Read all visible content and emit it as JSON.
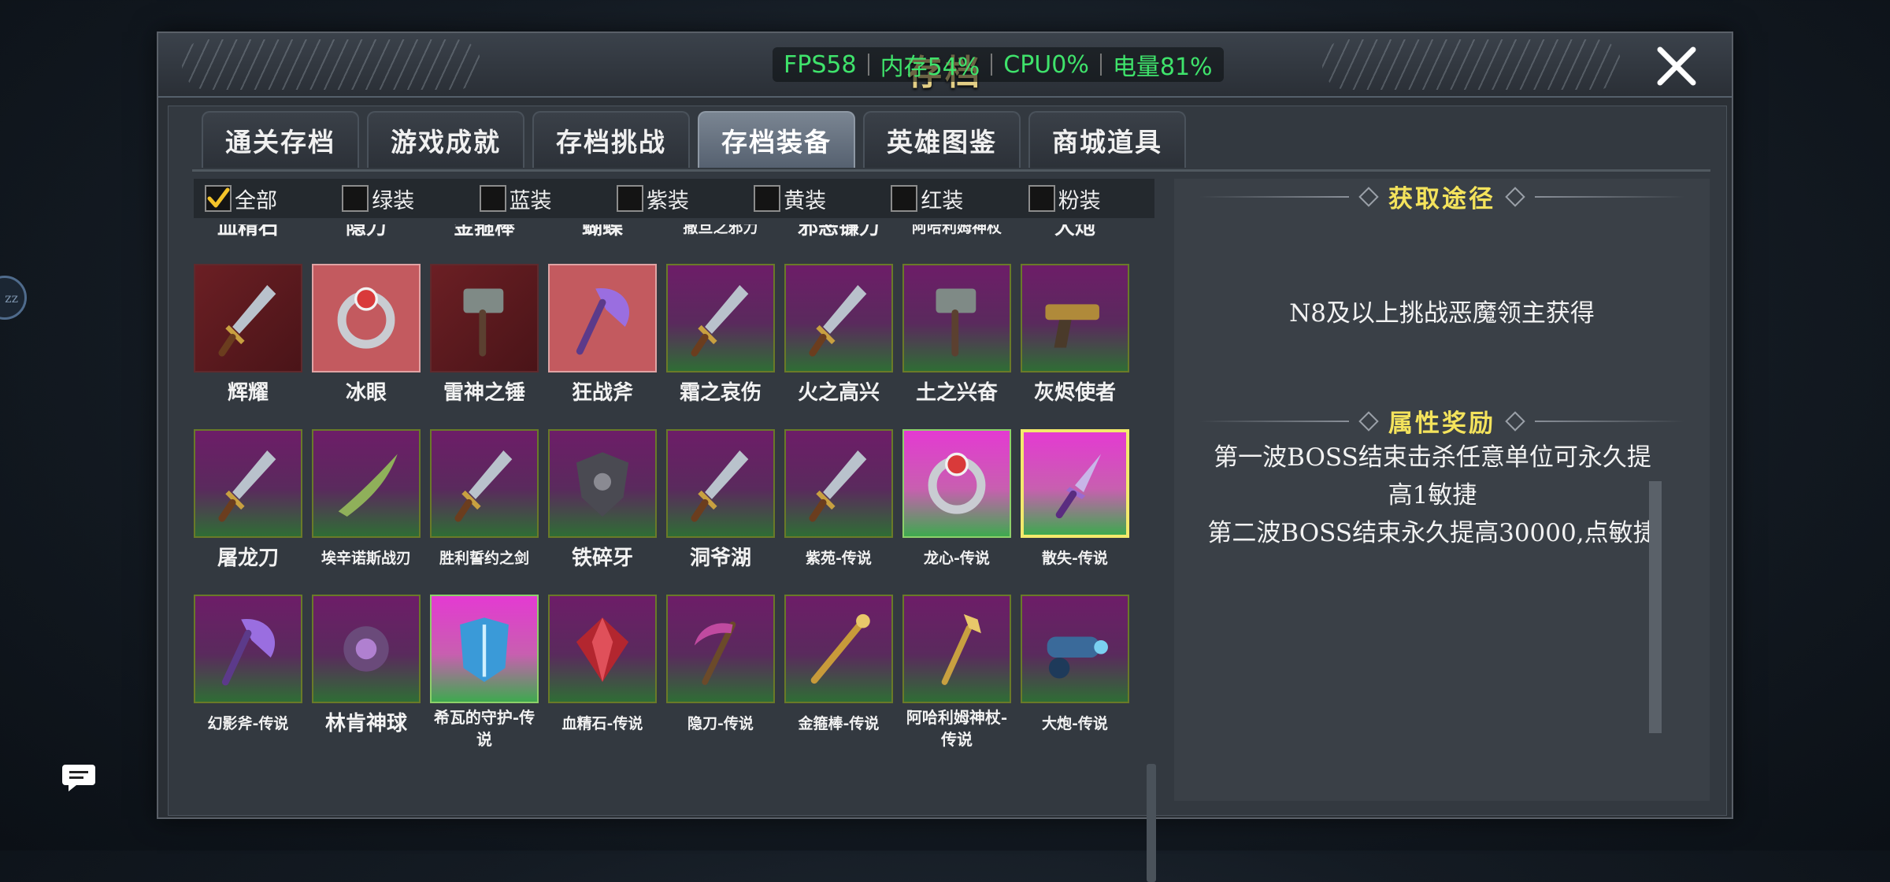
{
  "panel": {
    "title": "存档"
  },
  "perf": {
    "fps": "FPS58",
    "mem": "内存54%",
    "cpu": "CPU0%",
    "battery": "电量81%"
  },
  "side_badge": "zz",
  "tabs": [
    {
      "label": "通关存档",
      "active": false
    },
    {
      "label": "游戏成就",
      "active": false
    },
    {
      "label": "存档挑战",
      "active": false
    },
    {
      "label": "存档装备",
      "active": true
    },
    {
      "label": "英雄图鉴",
      "active": false
    },
    {
      "label": "商城道具",
      "active": false
    }
  ],
  "filters": [
    {
      "label": "全部",
      "checked": true
    },
    {
      "label": "绿装",
      "checked": false
    },
    {
      "label": "蓝装",
      "checked": false
    },
    {
      "label": "紫装",
      "checked": false
    },
    {
      "label": "黄装",
      "checked": false
    },
    {
      "label": "红装",
      "checked": false
    },
    {
      "label": "粉装",
      "checked": false
    }
  ],
  "items": [
    {
      "name": "血精石",
      "rarity": "red",
      "icon": "gem-icon"
    },
    {
      "name": "隐刀",
      "rarity": "pink",
      "icon": "dagger-icon"
    },
    {
      "name": "金箍棒",
      "rarity": "red",
      "icon": "staff-icon"
    },
    {
      "name": "蝴蝶",
      "rarity": "red",
      "icon": "blade-icon"
    },
    {
      "name": "撒旦之邪力",
      "rarity": "red",
      "icon": "fist-icon"
    },
    {
      "name": "邪恶镰刀",
      "rarity": "red",
      "icon": "scythe-icon"
    },
    {
      "name": "阿哈利姆神杖",
      "rarity": "red",
      "icon": "scepter-icon"
    },
    {
      "name": "大炮",
      "rarity": "pink",
      "icon": "cannon-icon"
    },
    {
      "name": "辉耀",
      "rarity": "red",
      "icon": "sword-icon"
    },
    {
      "name": "冰眼",
      "rarity": "pink",
      "icon": "ring-icon"
    },
    {
      "name": "雷神之锤",
      "rarity": "red",
      "icon": "hammer-icon"
    },
    {
      "name": "狂战斧",
      "rarity": "pink",
      "icon": "axe-icon"
    },
    {
      "name": "霜之哀伤",
      "rarity": "purple",
      "icon": "sword-icon"
    },
    {
      "name": "火之高兴",
      "rarity": "purple",
      "icon": "sword-icon"
    },
    {
      "name": "土之兴奋",
      "rarity": "purple",
      "icon": "hammer-icon"
    },
    {
      "name": "灰烬使者",
      "rarity": "purple",
      "icon": "gun-icon"
    },
    {
      "name": "屠龙刀",
      "rarity": "purple",
      "icon": "sword-icon"
    },
    {
      "name": "埃辛诺斯战刃",
      "rarity": "purple",
      "icon": "blade-icon"
    },
    {
      "name": "胜利誓约之剑",
      "rarity": "purple",
      "icon": "sword-icon"
    },
    {
      "name": "铁碎牙",
      "rarity": "purple",
      "icon": "shield-icon"
    },
    {
      "name": "洞爷湖",
      "rarity": "purple",
      "icon": "sword-icon"
    },
    {
      "name": "紫苑-传说",
      "rarity": "purple",
      "icon": "sword-icon"
    },
    {
      "name": "龙心-传说",
      "rarity": "magenta",
      "icon": "ring-icon"
    },
    {
      "name": "散失-传说",
      "rarity": "magenta",
      "icon": "dagger-icon",
      "selected": true
    },
    {
      "name": "幻影斧-传说",
      "rarity": "purple",
      "icon": "axe-icon"
    },
    {
      "name": "林肯神球",
      "rarity": "purple",
      "icon": "orb-icon"
    },
    {
      "name": "希瓦的守护-传说",
      "rarity": "magenta",
      "icon": "armor-icon"
    },
    {
      "name": "血精石-传说",
      "rarity": "purple",
      "icon": "gem-icon"
    },
    {
      "name": "隐刀-传说",
      "rarity": "purple",
      "icon": "scythe-icon"
    },
    {
      "name": "金箍棒-传说",
      "rarity": "purple",
      "icon": "staff-icon"
    },
    {
      "name": "阿哈利姆神杖-传说",
      "rarity": "purple",
      "icon": "scepter-icon"
    },
    {
      "name": "大炮-传说",
      "rarity": "purple",
      "icon": "cannon-icon"
    }
  ],
  "info": {
    "source_title": "获取途径",
    "source_text": "N8及以上挑战恶魔领主获得",
    "reward_title": "属性奖励",
    "reward_lines": [
      "第一波BOSS结束击杀任意单位可永久提高1敏捷",
      "第二波BOSS结束永久提高30000,点敏捷"
    ]
  },
  "colors": {
    "fps_green": "#3fe36b",
    "title_gold": "#e4cf86",
    "section_yellow": "#f4e35c",
    "selected_border": "#f3ea6c"
  }
}
